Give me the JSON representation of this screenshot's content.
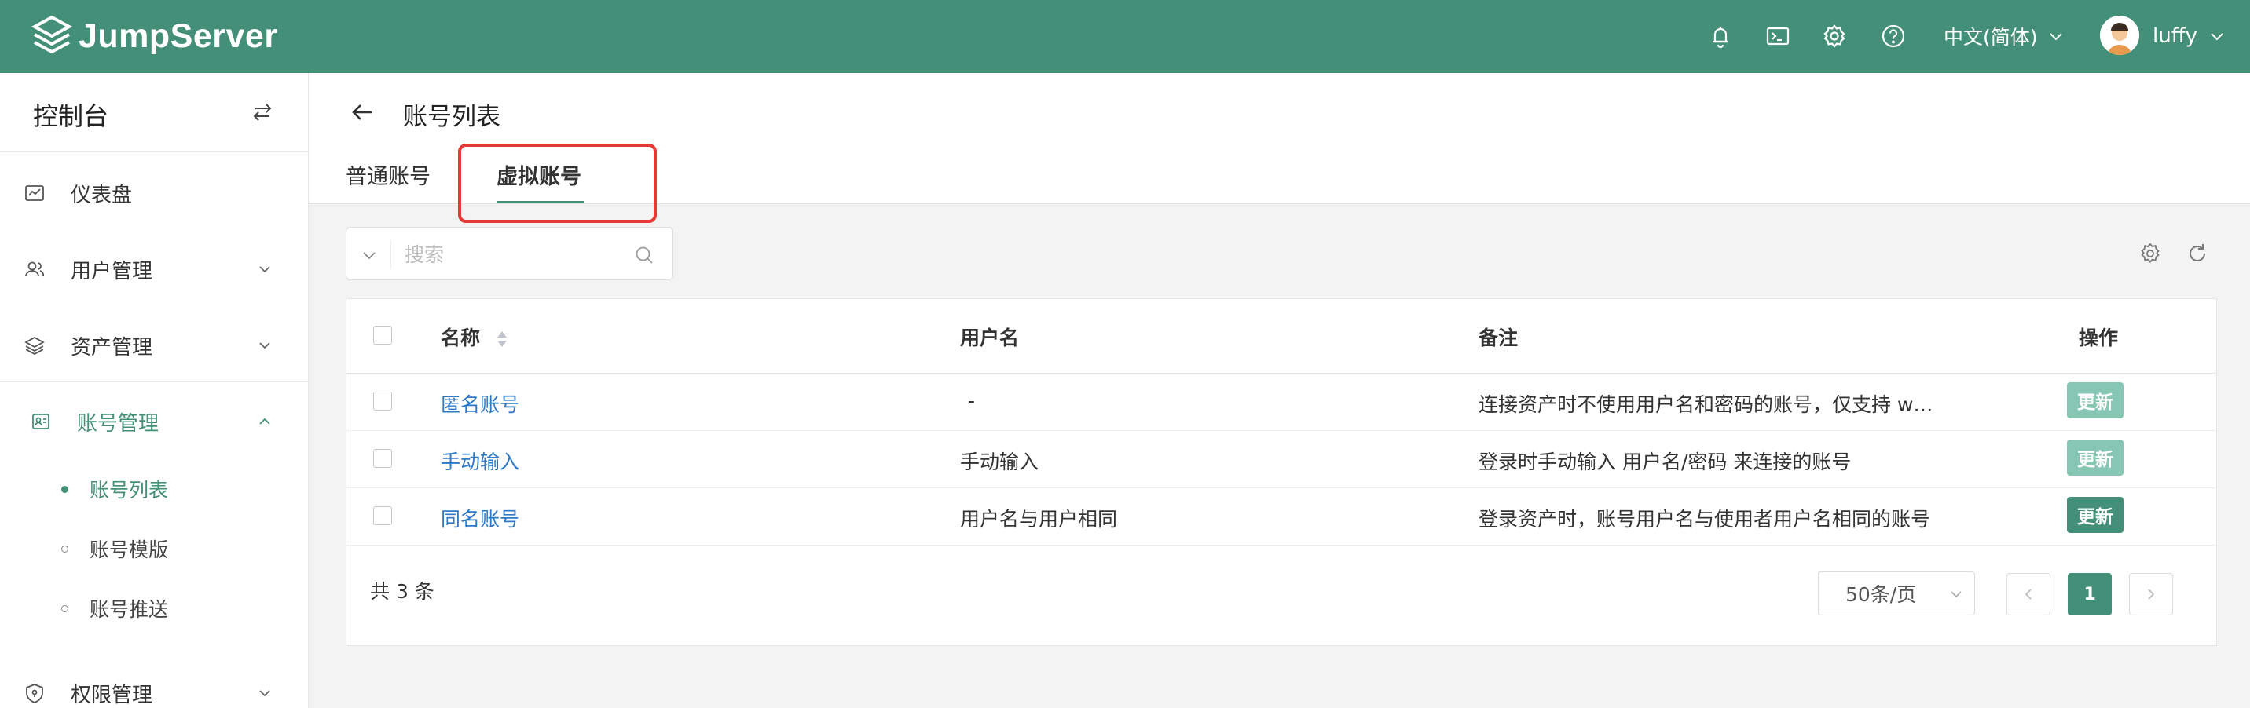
{
  "header": {
    "brand": "JumpServer",
    "language": "中文(简体)",
    "username": "luffy"
  },
  "sidebar": {
    "title": "控制台",
    "items": [
      {
        "label": "仪表盘",
        "icon": "dashboard-icon"
      },
      {
        "label": "用户管理",
        "icon": "users-icon"
      },
      {
        "label": "资产管理",
        "icon": "layers-icon"
      },
      {
        "label": "账号管理",
        "icon": "accounts-icon"
      },
      {
        "label": "权限管理",
        "icon": "shield-icon"
      }
    ],
    "subitems": [
      {
        "label": "账号列表"
      },
      {
        "label": "账号模版"
      },
      {
        "label": "账号推送"
      }
    ]
  },
  "page": {
    "title": "账号列表",
    "tabs": [
      {
        "label": "普通账号"
      },
      {
        "label": "虚拟账号"
      }
    ]
  },
  "search": {
    "placeholder": "搜索"
  },
  "table": {
    "columns": [
      "名称",
      "用户名",
      "备注",
      "操作"
    ],
    "rows": [
      {
        "name": "匿名账号",
        "username": "-",
        "comment": "连接资产时不使用用户名和密码的账号，仅支持 w…",
        "action": "更新"
      },
      {
        "name": "手动输入",
        "username": "手动输入",
        "comment": "登录时手动输入 用户名/密码 来连接的账号",
        "action": "更新"
      },
      {
        "name": "同名账号",
        "username": "用户名与用户相同",
        "comment": "登录资产时，账号用户名与使用者用户名相同的账号",
        "action": "更新"
      }
    ]
  },
  "pagination": {
    "total": "共 3 条",
    "page_size": "50条/页",
    "current_page": "1"
  },
  "colors": {
    "brand": "#438f77",
    "link": "#2e79c7",
    "highlight": "#e53935"
  }
}
